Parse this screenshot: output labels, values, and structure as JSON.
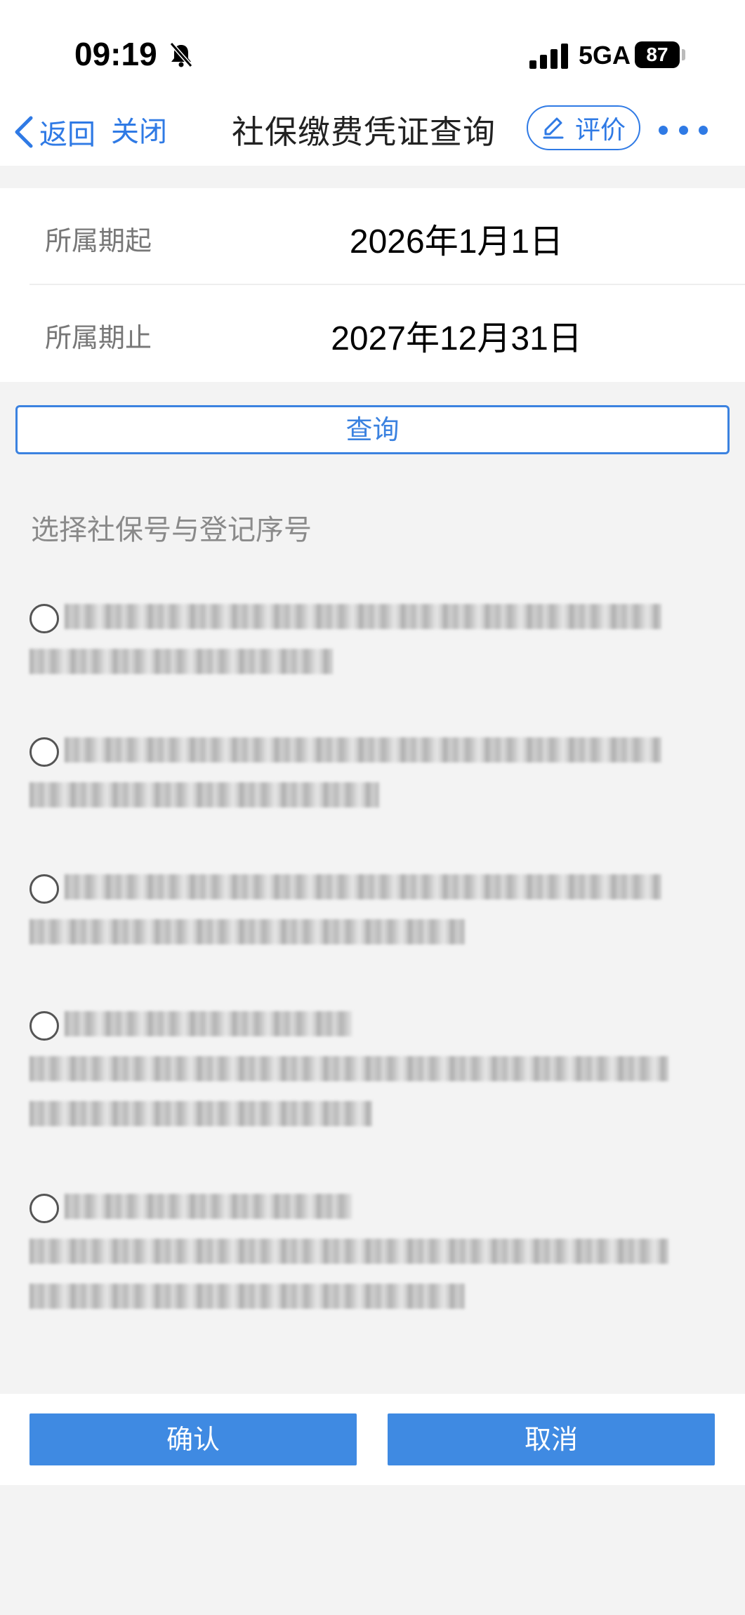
{
  "status_bar": {
    "time": "09:19",
    "network": "5GA",
    "battery": "87",
    "icons": [
      "bell-muted-icon",
      "signal-bars-icon",
      "battery-icon"
    ]
  },
  "nav": {
    "back_label": "返回",
    "close_label": "关闭",
    "title": "社保缴费凭证查询",
    "rate_label": "评价",
    "icons": [
      "chevron-left-icon",
      "edit-icon",
      "more-dots-icon"
    ],
    "accent_color": "#2f7ae5"
  },
  "form": {
    "start": {
      "label": "所属期起",
      "value": "2026年1月1日"
    },
    "end": {
      "label": "所属期止",
      "value": "2027年12月31日"
    }
  },
  "query_button": {
    "label": "查询",
    "color": "#3b82e0"
  },
  "selection": {
    "title": "选择社保号与登记序号",
    "options": [
      {
        "selected": false,
        "redacted_lines": 2
      },
      {
        "selected": false,
        "redacted_lines": 2
      },
      {
        "selected": false,
        "redacted_lines": 2
      },
      {
        "selected": false,
        "redacted_lines": 3
      },
      {
        "selected": false,
        "redacted_lines": 3
      }
    ]
  },
  "actions": {
    "confirm_label": "确认",
    "cancel_label": "取消",
    "button_color": "#3f8ae2"
  }
}
